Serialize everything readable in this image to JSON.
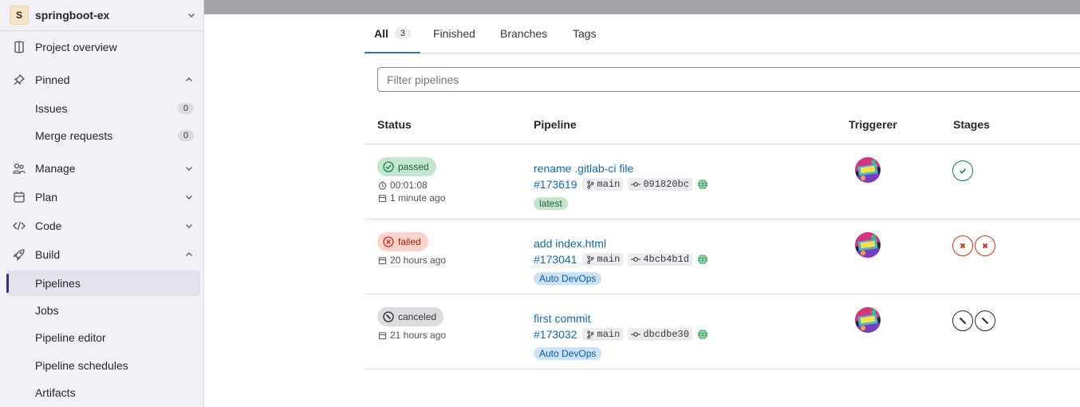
{
  "sidebar": {
    "project_initial": "S",
    "project_name": "springboot-ex",
    "items": [
      {
        "label": "Project overview"
      },
      {
        "label": "Pinned"
      },
      {
        "label": "Issues",
        "count": "0"
      },
      {
        "label": "Merge requests",
        "count": "0"
      },
      {
        "label": "Manage"
      },
      {
        "label": "Plan"
      },
      {
        "label": "Code"
      },
      {
        "label": "Build"
      },
      {
        "label": "Pipelines"
      },
      {
        "label": "Jobs"
      },
      {
        "label": "Pipeline editor"
      },
      {
        "label": "Pipeline schedules"
      },
      {
        "label": "Artifacts"
      }
    ]
  },
  "tabs": {
    "all": "All",
    "all_count": "3",
    "finished": "Finished",
    "branches": "Branches",
    "tags": "Tags"
  },
  "filter": {
    "placeholder": "Filter pipelines"
  },
  "table": {
    "headers": {
      "status": "Status",
      "pipeline": "Pipeline",
      "triggerer": "Triggerer",
      "stages": "Stages"
    },
    "rows": [
      {
        "status": "passed",
        "duration": "00:01:08",
        "finished": "1 minute ago",
        "title": "rename .gitlab-ci file",
        "id": "#173619",
        "branch": "main",
        "commit": "091820bc",
        "tag": "latest",
        "stages": [
          "success"
        ]
      },
      {
        "status": "failed",
        "finished": "20 hours ago",
        "title": "add index.html",
        "id": "#173041",
        "branch": "main",
        "commit": "4bcb4b1d",
        "tag": "Auto DevOps",
        "stages": [
          "failed",
          "failed"
        ]
      },
      {
        "status": "canceled",
        "finished": "21 hours ago",
        "title": "first commit",
        "id": "#173032",
        "branch": "main",
        "commit": "dbcdbe30",
        "tag": "Auto DevOps",
        "stages": [
          "canceled",
          "canceled"
        ]
      }
    ]
  },
  "colors": {
    "passed": "#108548",
    "failed": "#dd2b0e",
    "link": "#1068bf",
    "active_tab": "#1f75cb"
  }
}
